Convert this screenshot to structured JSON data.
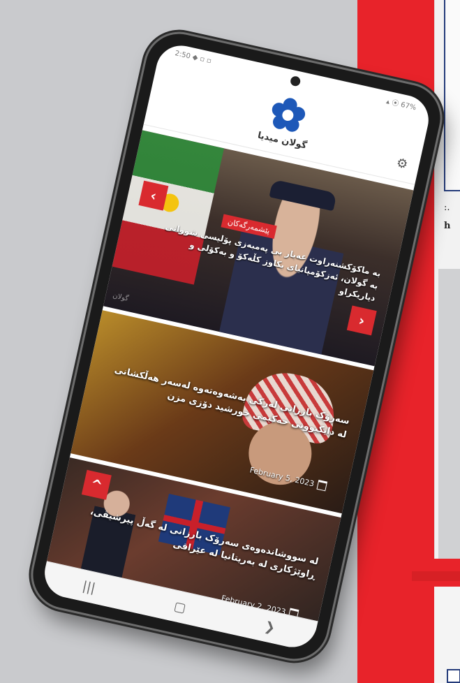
{
  "background": {
    "panel_texts": [
      ":.",
      "h"
    ]
  },
  "app": {
    "status_left": "2:50 ◆ ▫ ▫",
    "status_right": "▴ ⦿ 67%",
    "brand_name": "گولان میدیا"
  },
  "slider": {
    "badge": "پێشمەرگەکان",
    "title": "بە ماکۆکشنەراوت عەبار بی پەمبەزی پۆلیسی شووانی بە گولان، ئەزکۆمپانیای بکاوز کڵەکۆ و بەکۆلی و دیاریکراو",
    "prev_label": "‹",
    "next_label": "›",
    "watermark": "گولان"
  },
  "articles": [
    {
      "title": "سەرۆک بارزانی لەرکی بەشەوەتەوە لەسەر هەڵکشانی لە دایکبوونی حەکیمی خورشید دۆزی مزن",
      "date": "February 5, 2023"
    },
    {
      "title": "لە سووشاندەوەی سەرۆک بارزانی لە گەڵ پیرشیڤی، ڕاوێژکاری لە بەریتانیا لە عێراقی",
      "date": "February 2, 2023"
    }
  ],
  "nav": {
    "recent": "|||",
    "home": "▢",
    "back": "❯"
  },
  "colors": {
    "accent": "#d92a2f",
    "brand_blue": "#1d58b8"
  }
}
